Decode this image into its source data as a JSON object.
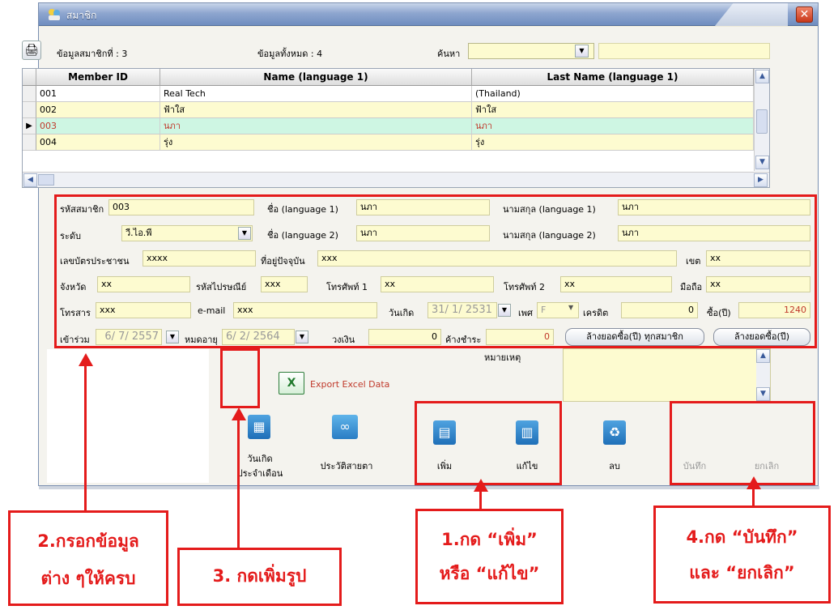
{
  "window": {
    "title": "สมาชิก",
    "close_glyph": "✕"
  },
  "toolbar": {
    "member_info": "ข้อมูลสมาชิกที่ : 3",
    "total_info": "ข้อมูลทั้งหมด : 4",
    "search_label": "ค้นหา",
    "search_value": ""
  },
  "grid": {
    "headers": [
      "Member ID",
      "Name (language 1)",
      "Last Name (language 1)"
    ],
    "rows": [
      {
        "id": "001",
        "name": "Real Tech",
        "last": "(Thailand)"
      },
      {
        "id": "002",
        "name": "ฟ้าใส",
        "last": "ฟ้าใส"
      },
      {
        "id": "003",
        "name": "นภา",
        "last": "นภา"
      },
      {
        "id": "004",
        "name": "รุ่ง",
        "last": "รุ่ง"
      }
    ],
    "selected_row": 2,
    "row_colors": [
      "#ffffff",
      "#fdfbd0",
      "#cef6e3",
      "#fdfbd0"
    ]
  },
  "form": {
    "member_code_label": "รหัสสมาชิก",
    "member_code": "003",
    "name1_label": "ชื่อ (language 1)",
    "name1": "นภา",
    "last1_label": "นามสกุล (language 1)",
    "last1": "นภา",
    "level_label": "ระดับ",
    "level": "วี.ไอ.พี",
    "name2_label": "ชื่อ (language 2)",
    "name2": "นภา",
    "last2_label": "นามสกุล (language 2)",
    "last2": "นภา",
    "idcard_label": "เลขบัตรประชาชน",
    "idcard": "xxxx",
    "address_label": "ที่อยู่ปัจจุบัน",
    "address": "xxx",
    "district_label": "เขต",
    "district": "xx",
    "province_label": "จังหวัด",
    "province": "xx",
    "postcode_label": "รหัสไปรษณีย์",
    "postcode": "xxx",
    "phone1_label": "โทรศัพท์ 1",
    "phone1": "xx",
    "phone2_label": "โทรศัพท์ 2",
    "phone2": "xx",
    "mobile_label": "มือถือ",
    "mobile": "xx",
    "fax_label": "โทรสาร",
    "fax": "xxx",
    "email_label": "e-mail",
    "email": "xxx",
    "birth_label": "วันเกิด",
    "birth": "31/ 1/ 2531",
    "sex_label": "เพศ",
    "sex": "F",
    "credit_label": "เครดิต",
    "credit": "0",
    "buy_label": "ซื้อ(ปี)",
    "buy": "1240",
    "join_label": "เข้าร่วม",
    "join": "6/ 7/ 2557",
    "expire_label": "หมดอายุ",
    "expire": "6/ 2/ 2564",
    "limit_label": "วงเงิน",
    "limit": "0",
    "owed_label": "ค้างชำระ",
    "owed": "0",
    "clear_all_btn": "ล้างยอดซื้อ(ปี) ทุกสมาชิก",
    "clear_btn": "ล้างยอดซื้อ(ปี)",
    "note_label": "หมายเหตุ"
  },
  "actions": {
    "export": "Export Excel Data",
    "birthday": [
      "วันเกิด",
      "ประจำเดือน"
    ],
    "eye_history": "ประวัติสายตา",
    "add": "เพิ่ม",
    "edit": "แก้ไข",
    "delete": "ลบ",
    "save": "บันทึก",
    "cancel": "ยกเลิก"
  },
  "annotations": {
    "step2": [
      "2.กรอกข้อมูล",
      "ต่าง ๆให้ครบ"
    ],
    "step3": "3. กดเพิ่มรูป",
    "step1": [
      "1.กด “เพิ่ม”",
      "หรือ “แก้ไข”"
    ],
    "step4": [
      "4.กด “บันทึก”",
      "และ “ยกเลิก”"
    ]
  },
  "colors": {
    "accent_red": "#e41b1b",
    "field_bg": "#fdfbd0",
    "selected_row": "#cef6e3"
  }
}
